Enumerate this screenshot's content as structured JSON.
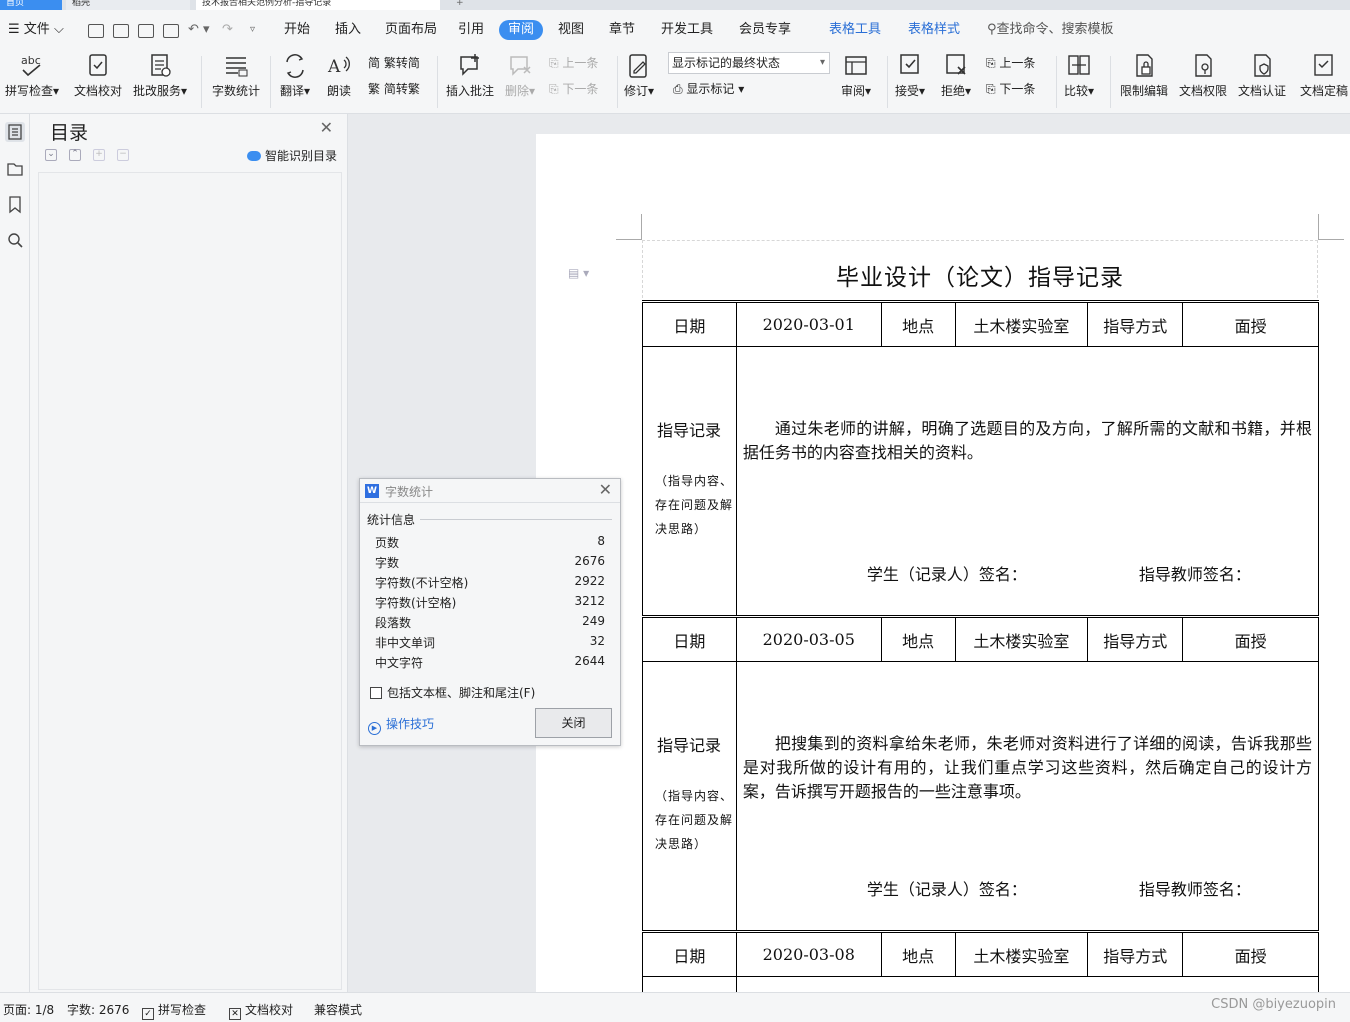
{
  "tabs": {
    "home": "首页",
    "doc1": "稻壳",
    "doc2": "技术报告相关范例分析-指导记录",
    "close": "×",
    "plus": "+"
  },
  "menu": {
    "file": "文件",
    "items": [
      "开始",
      "插入",
      "页面布局",
      "引用",
      "审阅",
      "视图",
      "章节",
      "开发工具",
      "会员专享"
    ],
    "active": "审阅",
    "table_tools": "表格工具",
    "table_style": "表格样式",
    "search": "查找命令、搜索模板"
  },
  "ribbon": {
    "spell": "拼写检查",
    "proof": "文档校对",
    "review_service": "批改服务",
    "word_count": "字数统计",
    "translate": "翻译",
    "read": "朗读",
    "trad": "繁转简",
    "simp": "简转繁",
    "insert_comment": "插入批注",
    "delete": "删除",
    "prev": "上一条",
    "next": "下一条",
    "track": "修订",
    "markup_select": "显示标记的最终状态",
    "show_markup": "显示标记",
    "review": "审阅",
    "accept": "接受",
    "reject": "拒绝",
    "prev2": "上一条",
    "next2": "下一条",
    "compare": "比较",
    "restrict": "限制编辑",
    "permission": "文档权限",
    "certify": "文档认证",
    "finalize": "文档定稿"
  },
  "toc": {
    "title": "目录",
    "ai": "智能识别目录"
  },
  "document": {
    "title": "毕业设计（论文）指导记录",
    "header": {
      "date_label": "日期",
      "place_label": "地点",
      "place": "土木楼实验室",
      "mode_label": "指导方式",
      "mode": "面授"
    },
    "record_label": "指导记录",
    "record_sub": "（指导内容、存在问题及解决思路）",
    "sig_student": "学生（记录人）签名：",
    "sig_teacher": "指导教师签名：",
    "entries": [
      {
        "date": "2020-03-01",
        "text": "通过朱老师的讲解，明确了选题目的及方向，了解所需的文献和书籍，并根据任务书的内容查找相关的资料。"
      },
      {
        "date": "2020-03-05",
        "text": "把搜集到的资料拿给朱老师，朱老师对资料进行了详细的阅读，告诉我那些是对我所做的设计有用的，让我们重点学习这些资料，然后确定自己的设计方案，告诉撰写开题报告的一些注意事项。"
      },
      {
        "date": "2020-03-08"
      }
    ]
  },
  "dialog": {
    "title": "字数统计",
    "section": "统计信息",
    "stats": [
      {
        "label": "页数",
        "value": "8"
      },
      {
        "label": "字数",
        "value": "2676"
      },
      {
        "label": "字符数(不计空格)",
        "value": "2922"
      },
      {
        "label": "字符数(计空格)",
        "value": "3212"
      },
      {
        "label": "段落数",
        "value": "249"
      },
      {
        "label": "非中文单词",
        "value": "32"
      },
      {
        "label": "中文字符",
        "value": "2644"
      }
    ],
    "checkbox": "包括文本框、脚注和尾注(F)",
    "tips": "操作技巧",
    "close": "关闭"
  },
  "status": {
    "page": "页面: 1/8",
    "words": "字数: 2676",
    "spell": "拼写检查",
    "proof": "文档校对",
    "compat": "兼容模式",
    "watermark": "CSDN @biyezuopin"
  },
  "colors": {
    "accent": "#3b8ef0",
    "link": "#2a6fd6"
  }
}
